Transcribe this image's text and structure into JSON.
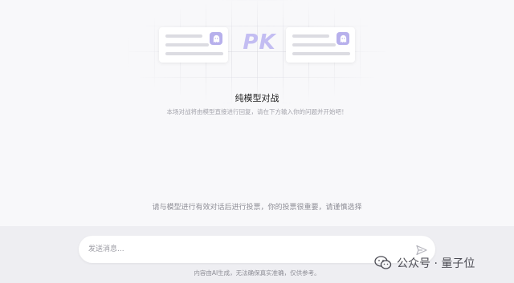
{
  "hero": {
    "pk_text": "PK",
    "title": "纯模型对战",
    "subtitle": "本场对战将由模型直接进行回复，请在下方输入你的问题并开始吧！",
    "avatar_icon": "ghost-avatar-icon",
    "accent_color": "#b7b0ec"
  },
  "hint": "请与模型进行有效对话后进行投票，你的投票很重要，请谨慎选择",
  "composer": {
    "placeholder": "发送消息...",
    "send_icon": "send-icon"
  },
  "footer": {
    "disclaimer": "内容由AI生成，无法确保真实准确，仅供参考。"
  },
  "watermark": {
    "text": "公众号 · 量子位",
    "icon": "wechat-icon"
  }
}
